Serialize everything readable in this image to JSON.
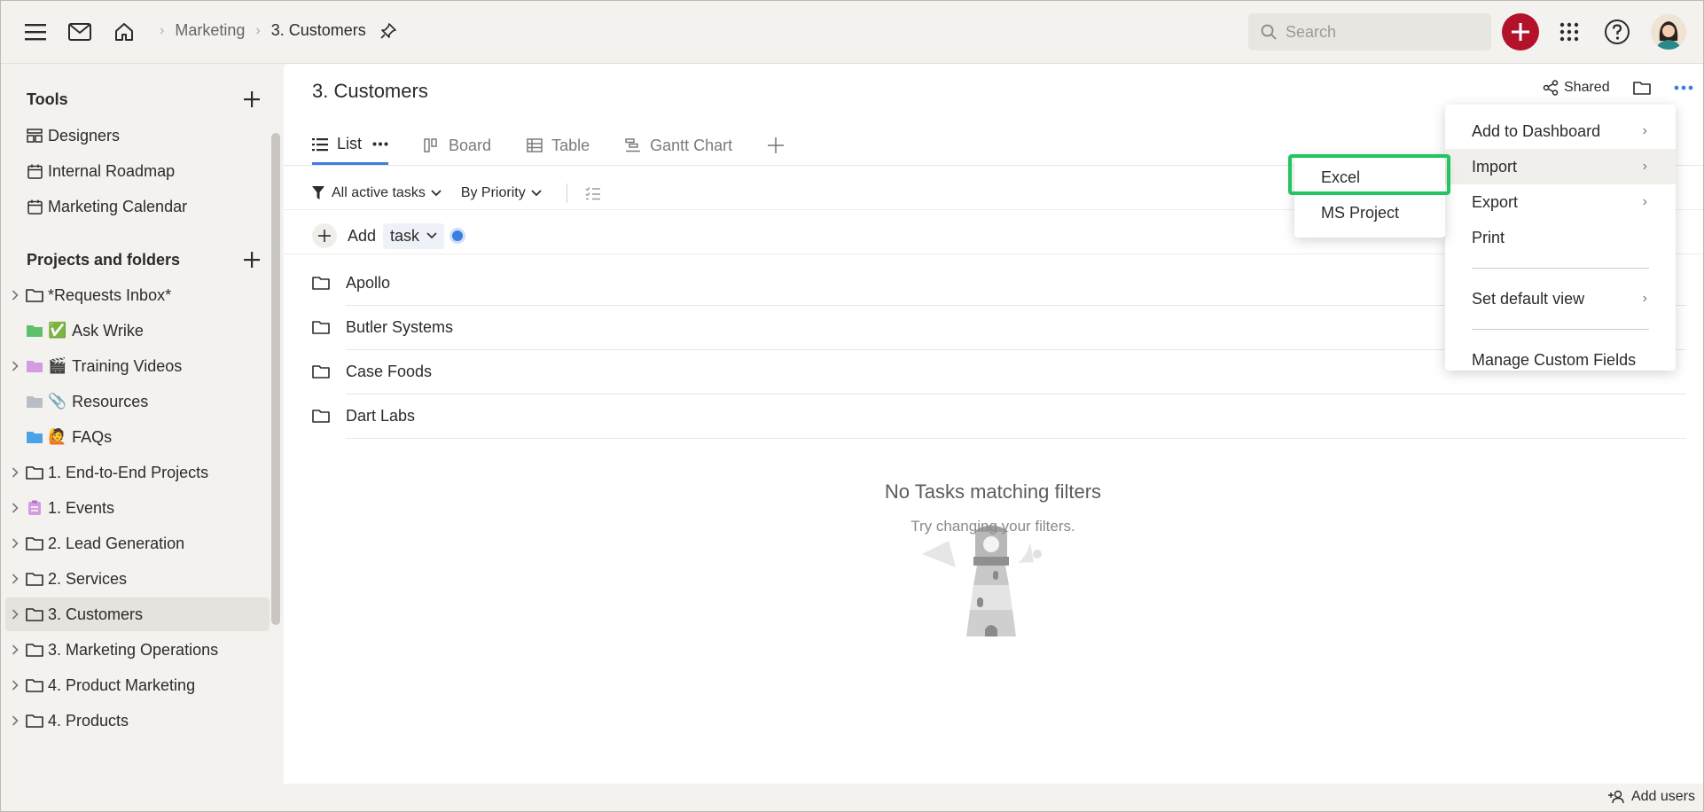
{
  "topbar": {
    "breadcrumb": [
      "Marketing",
      "3. Customers"
    ],
    "search_placeholder": "Search",
    "icons": [
      "hamburger-icon",
      "mail-icon",
      "home-icon",
      "pin-icon",
      "search-icon",
      "plus-icon",
      "apps-grid-icon",
      "help-icon"
    ],
    "accent": "#b3122b"
  },
  "sidebar": {
    "tools_heading": "Tools",
    "tools": [
      {
        "label": "Designers",
        "icon": "blueprint-icon"
      },
      {
        "label": "Internal Roadmap",
        "icon": "calendar-icon"
      },
      {
        "label": "Marketing Calendar",
        "icon": "calendar-icon"
      }
    ],
    "projects_heading": "Projects and folders",
    "projects": [
      {
        "label": "*Requests Inbox*",
        "icon": "folder-outline-icon",
        "expandable": true
      },
      {
        "label": "Ask Wrike",
        "emoji": "✅",
        "icon": "folder-green-icon",
        "expandable": false
      },
      {
        "label": "Training Videos",
        "emoji": "🎬",
        "icon": "folder-pink-icon",
        "expandable": true
      },
      {
        "label": "Resources",
        "emoji": "📎",
        "icon": "folder-gray-icon",
        "expandable": false
      },
      {
        "label": "FAQs",
        "emoji": "🙋",
        "icon": "folder-blue-icon",
        "expandable": false
      },
      {
        "label": "1. End-to-End Projects",
        "icon": "folder-outline-icon",
        "expandable": true
      },
      {
        "label": "1. Events",
        "icon": "project-purple-icon",
        "expandable": true
      },
      {
        "label": "2. Lead Generation",
        "icon": "folder-outline-icon",
        "expandable": true
      },
      {
        "label": "2. Services",
        "icon": "folder-outline-icon",
        "expandable": true
      },
      {
        "label": "3. Customers",
        "icon": "folder-outline-icon",
        "expandable": true,
        "selected": true
      },
      {
        "label": "3. Marketing Operations",
        "icon": "folder-outline-icon",
        "expandable": true
      },
      {
        "label": "4. Product Marketing",
        "icon": "folder-outline-icon",
        "expandable": true
      },
      {
        "label": "4. Products",
        "icon": "folder-outline-icon",
        "expandable": true
      }
    ]
  },
  "main": {
    "title": "3. Customers",
    "shared_label": "Shared",
    "tabs": [
      {
        "label": "List",
        "active": true
      },
      {
        "label": "Board"
      },
      {
        "label": "Table"
      },
      {
        "label": "Gantt Chart"
      }
    ],
    "filters": {
      "status": "All active tasks",
      "sort": "By Priority"
    },
    "add_row": {
      "add_label": "Add",
      "type": "task"
    },
    "folders": [
      "Apollo",
      "Butler Systems",
      "Case Foods",
      "Dart Labs"
    ],
    "empty_title": "No Tasks matching filters",
    "empty_sub": "Try changing your filters."
  },
  "more_menu": {
    "items": [
      {
        "label": "Add to Dashboard",
        "submenu": true
      },
      {
        "label": "Import",
        "submenu": true,
        "hover": true
      },
      {
        "label": "Export",
        "submenu": true
      },
      {
        "label": "Print",
        "submenu": false
      },
      {
        "label": "Set default view",
        "submenu": true
      },
      {
        "label": "Manage Custom Fields",
        "submenu": false
      }
    ]
  },
  "import_submenu": {
    "items": [
      "Excel",
      "MS Project"
    ],
    "highlighted": "Excel",
    "highlight_color": "#22c55e"
  },
  "footer": {
    "add_users": "Add users"
  }
}
